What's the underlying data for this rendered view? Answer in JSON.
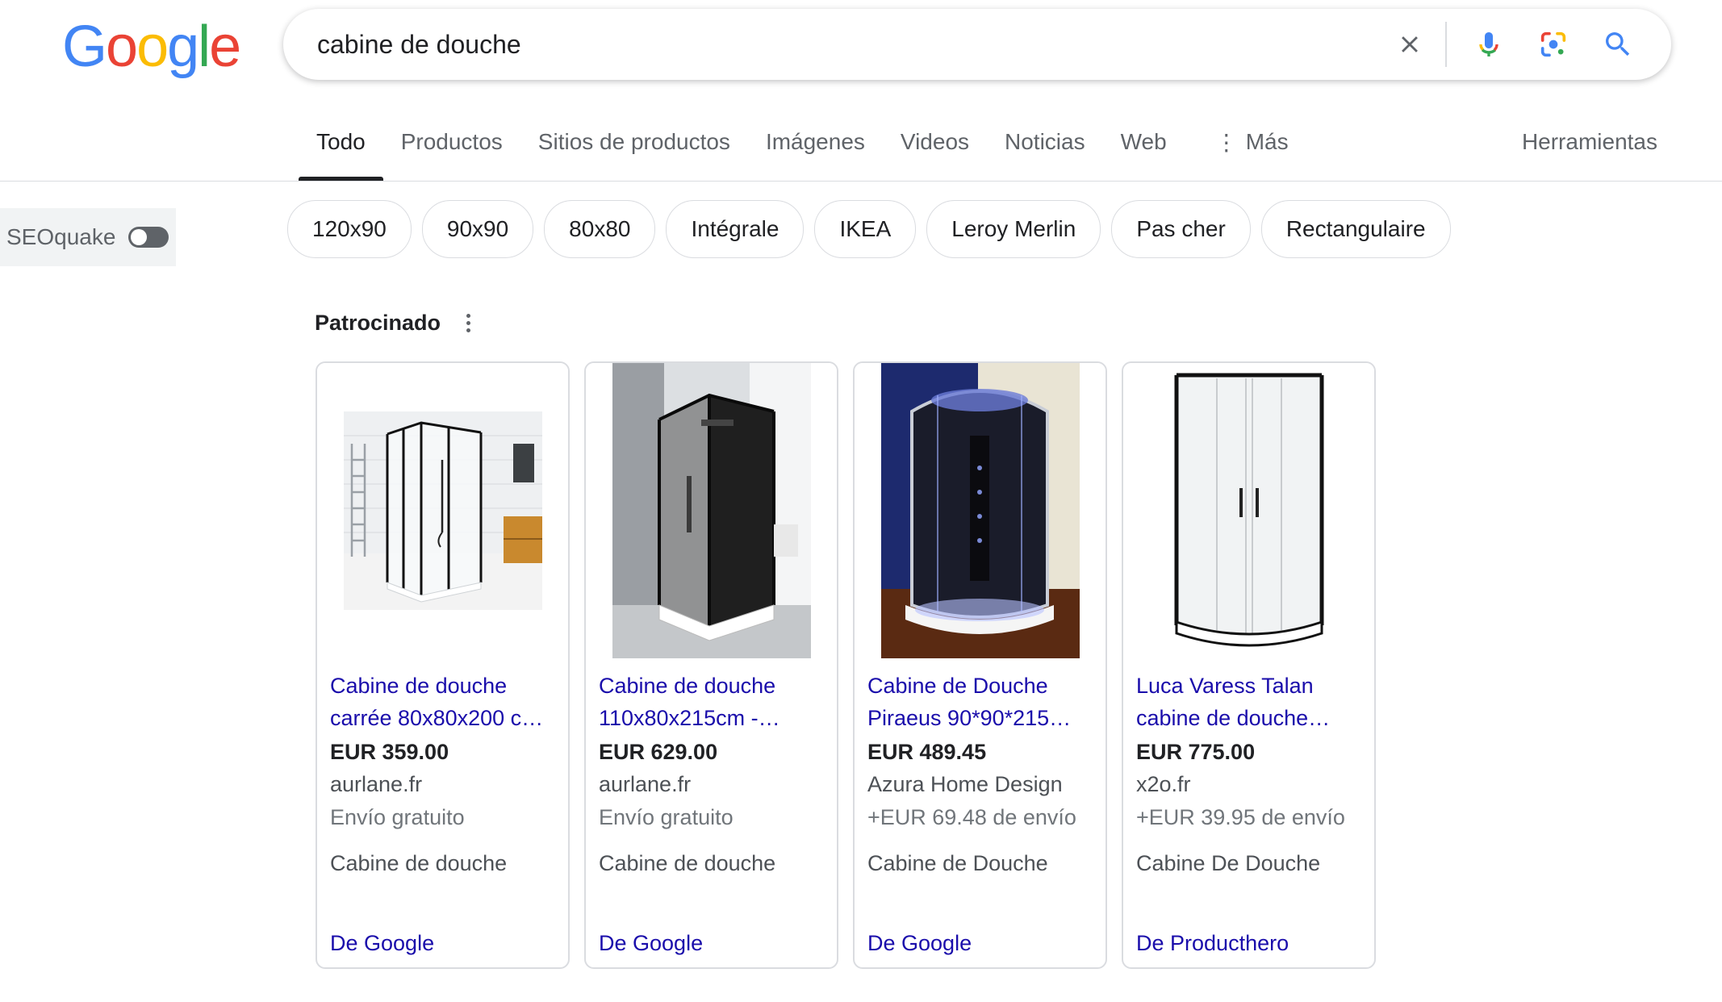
{
  "logo": {
    "letters": [
      "G",
      "o",
      "o",
      "g",
      "l",
      "e"
    ],
    "colors": [
      "#4285F4",
      "#EA4335",
      "#FBBC05",
      "#4285F4",
      "#34A853",
      "#EA4335"
    ]
  },
  "search": {
    "query": "cabine de douche"
  },
  "tabs": [
    {
      "label": "Todo",
      "active": true
    },
    {
      "label": "Productos"
    },
    {
      "label": "Sitios de productos"
    },
    {
      "label": "Imágenes"
    },
    {
      "label": "Videos"
    },
    {
      "label": "Noticias"
    },
    {
      "label": "Web"
    },
    {
      "label": "Más",
      "icon": "more-vert-icon"
    }
  ],
  "tools_label": "Herramientas",
  "seoquake": {
    "label": "SEOquake",
    "enabled": false
  },
  "chips": [
    "120x90",
    "90x90",
    "80x80",
    "Intégrale",
    "IKEA",
    "Leroy Merlin",
    "Pas cher",
    "Rectangulaire"
  ],
  "sponsored": {
    "title": "Patrocinado"
  },
  "products": [
    {
      "title_line1": "Cabine de douche",
      "title_line2": "carrée 80x80x200 c…",
      "price": "EUR 359.00",
      "store": "aurlane.fr",
      "shipping": "Envío gratuito",
      "category": "Cabine de douche",
      "source": "De Google"
    },
    {
      "title_line1": "Cabine de douche",
      "title_line2": "110x80x215cm -…",
      "price": "EUR 629.00",
      "store": "aurlane.fr",
      "shipping": "Envío gratuito",
      "category": "Cabine de douche",
      "source": "De Google"
    },
    {
      "title_line1": "Cabine de Douche",
      "title_line2": "Piraeus 90*90*215…",
      "price": "EUR 489.45",
      "store": "Azura Home Design",
      "shipping": "+EUR 69.48 de envío",
      "category": "Cabine de Douche",
      "source": "De Google"
    },
    {
      "title_line1": "Luca Varess Talan",
      "title_line2": "cabine de douche…",
      "price": "EUR 775.00",
      "store": "x2o.fr",
      "shipping": "+EUR 39.95 de envío",
      "category": "Cabine De Douche",
      "source": "De Producthero"
    }
  ]
}
